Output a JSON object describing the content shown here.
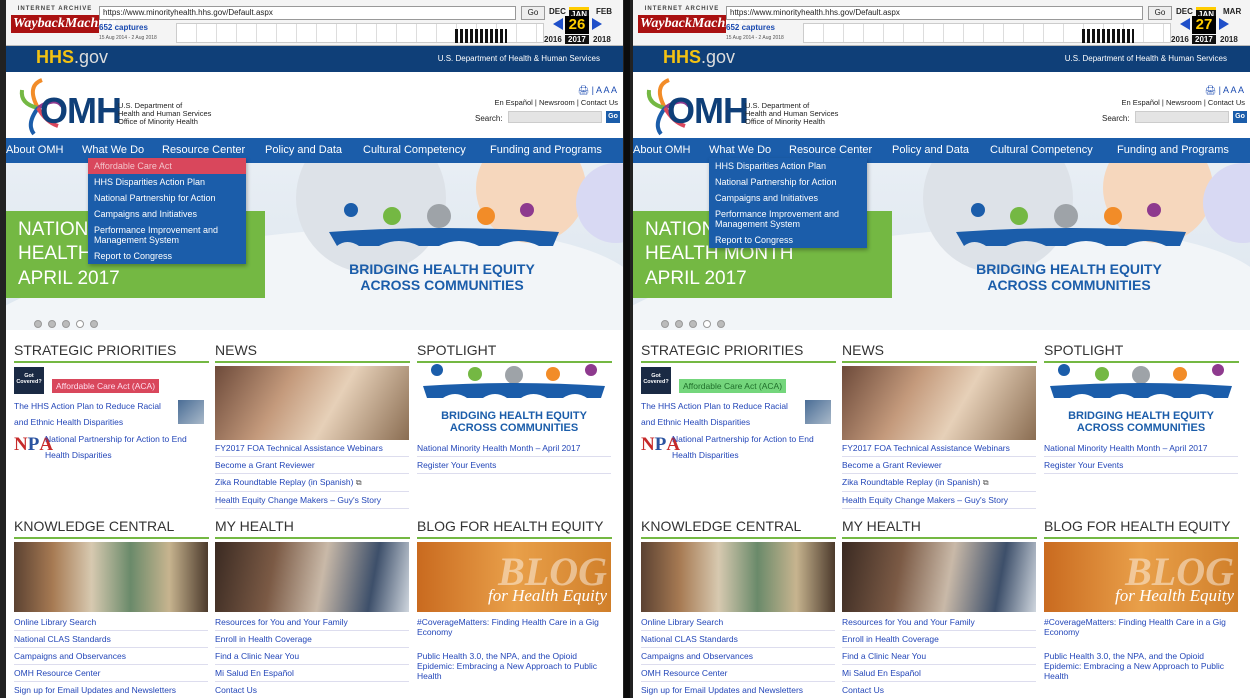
{
  "panels": [
    {
      "wayback": {
        "archive_label": "INTERNET ARCHIVE",
        "wordmark": "WaybackMachine",
        "url": "https://www.minorityhealth.hhs.gov/Default.aspx",
        "go": "Go",
        "captures": "652 captures",
        "range": "15 Aug 2014 - 2 Aug 2018",
        "month_prev": "DEC",
        "month_cur": "JAN",
        "month_next": "FEB",
        "day": "26",
        "year_prev": "2016",
        "year_cur": "2017",
        "year_next": "2018"
      },
      "highlight_color": "#d9475c"
    },
    {
      "wayback": {
        "archive_label": "INTERNET ARCHIVE",
        "wordmark": "WaybackMachine",
        "url": "https://www.minorityhealth.hhs.gov/Default.aspx",
        "go": "Go",
        "captures": "652 captures",
        "range": "15 Aug 2014 - 2 Aug 2018",
        "month_prev": "DEC",
        "month_cur": "JAN",
        "month_next": "MAR",
        "day": "27",
        "year_prev": "2016",
        "year_cur": "2017",
        "year_next": "2018"
      },
      "highlight_color": "#74d67c"
    }
  ],
  "site": {
    "hhs_brand": "HHS",
    "hhs_suffix": ".gov",
    "hhs_dept": "U.S. Department of Health & Human Services",
    "omh": "OMH",
    "omh_dept": [
      "U.S. Department of",
      "Health and Human Services",
      "Office of Minority Health"
    ],
    "header_links": "En Español | Newsroom | Contact Us",
    "print_tools": "🖨 | A A A",
    "search_label": "Search:",
    "search_go": "Go",
    "nav": [
      "About OMH",
      "What We Do",
      "Resource Center",
      "Policy and Data",
      "Cultural Competency",
      "Funding and Programs"
    ],
    "dropdown_left": [
      "Affordable Care Act",
      "HHS Disparities Action Plan",
      "National Partnership for Action",
      "Campaigns and Initiatives",
      "Performance Improvement and Management System",
      "Report to Congress"
    ],
    "dropdown_right": [
      "HHS Disparities Action Plan",
      "National Partnership for Action",
      "Campaigns and Initiatives",
      "Performance Improvement and Management System",
      "Report to Congress"
    ],
    "hero": {
      "line1": "NATIONAL MINORITY",
      "line2": "HEALTH MONTH",
      "line3": "APRIL 2017",
      "bridge1": "BRIDGING HEALTH EQUITY",
      "bridge2": "ACROSS COMMUNITIES"
    },
    "strategic": {
      "title": "STRATEGIC PRIORITIES",
      "got_covered": "Got Covered?",
      "aca": "Affordable Care Act (ACA)",
      "hhs_plan": [
        "The HHS Action Plan to Reduce Racial",
        "and Ethnic Health Disparities"
      ],
      "npa_logo": "NPA",
      "npa": [
        "National Partnership for Action to End",
        "Health Disparities"
      ]
    },
    "news": {
      "title": "NEWS",
      "links": [
        "FY2017 FOA Technical Assistance Webinars",
        "Become a Grant Reviewer",
        "Zika Roundtable Replay (in Spanish)",
        "Health Equity Change Makers – Guy's Story"
      ]
    },
    "spotlight": {
      "title": "SPOTLIGHT",
      "bridge1": "BRIDGING HEALTH EQUITY",
      "bridge2": "ACROSS COMMUNITIES",
      "links": [
        "National Minority Health Month – April 2017",
        "Register Your Events"
      ]
    },
    "knowledge": {
      "title": "KNOWLEDGE CENTRAL",
      "links": [
        "Online Library Search",
        "National CLAS Standards",
        "Campaigns and Observances",
        "OMH Resource Center",
        "Sign up for Email Updates and Newsletters"
      ]
    },
    "myhealth": {
      "title": "MY HEALTH",
      "links": [
        "Resources for You and Your Family",
        "Enroll in Health Coverage",
        "Find a Clinic Near You",
        "Mi Salud En Español",
        "Contact Us"
      ]
    },
    "blog": {
      "title": "BLOG FOR HEALTH EQUITY",
      "img_word": "BLOG",
      "img_sub": "for Health Equity",
      "links": [
        "#CoverageMatters: Finding Health Care in a Gig Economy",
        "Public Health 3.0, the NPA, and the Opioid Epidemic: Embracing a New Approach to Public Health"
      ]
    }
  }
}
